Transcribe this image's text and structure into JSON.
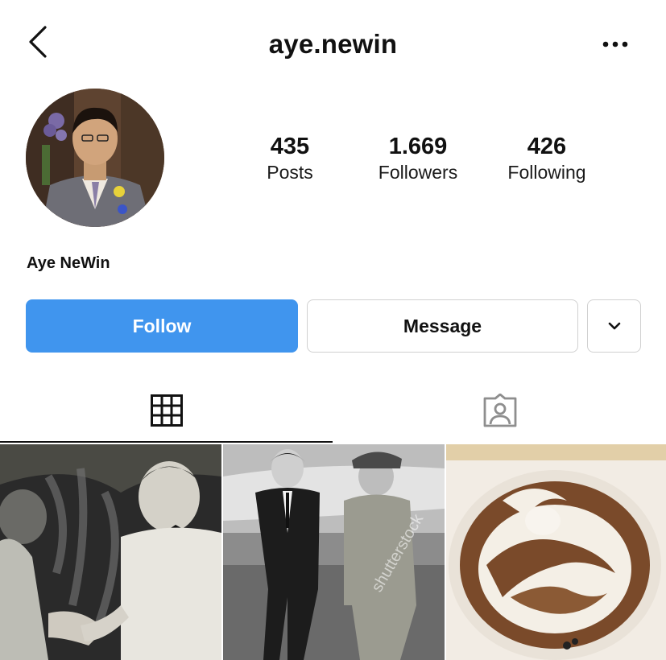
{
  "header": {
    "username": "aye.newin"
  },
  "profile": {
    "display_name": "Aye NeWin",
    "stats": [
      {
        "value": "435",
        "label": "Posts"
      },
      {
        "value": "1.669",
        "label": "Followers"
      },
      {
        "value": "426",
        "label": "Following"
      }
    ]
  },
  "actions": {
    "follow_label": "Follow",
    "message_label": "Message"
  },
  "tabs": [
    {
      "icon": "grid-icon"
    },
    {
      "icon": "tagged-icon"
    }
  ],
  "posts": [
    {
      "type": "photo",
      "description_icon": "photo-handshake"
    },
    {
      "type": "photo",
      "description_icon": "photo-airport-walk",
      "watermark": "shutterstock"
    },
    {
      "type": "photo",
      "description_icon": "photo-latte-art"
    }
  ],
  "colors": {
    "follow_button": "#4095ee",
    "tab_indicator": "#111111"
  }
}
